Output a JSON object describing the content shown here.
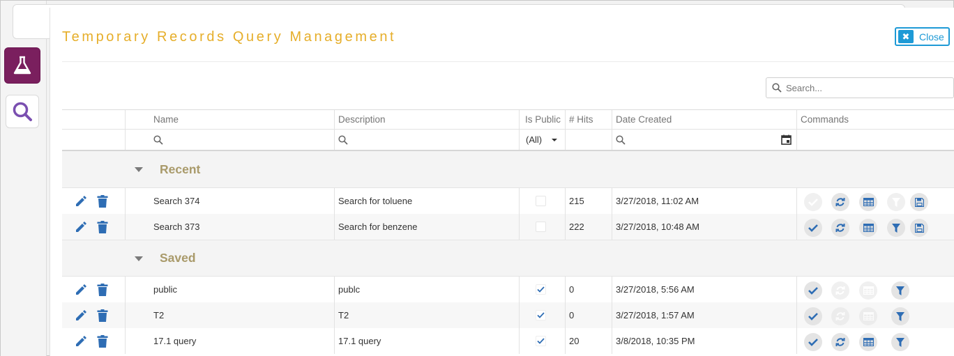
{
  "rail": {
    "items": [
      {
        "name": "table-view",
        "icon": "grid-table-icon",
        "color": "#e6ae2a"
      },
      {
        "name": "queries",
        "icon": "flask-icon",
        "color": "#7a1f5e"
      },
      {
        "name": "search",
        "icon": "magnifier-icon",
        "color": "#7a4fb0"
      }
    ]
  },
  "header": {
    "title": "Temporary Records Query Management",
    "close_label": "Close",
    "search_placeholder": "Search..."
  },
  "columns": {
    "name": "Name",
    "description": "Description",
    "is_public": "Is Public",
    "hits": "# Hits",
    "date_created": "Date Created",
    "commands": "Commands"
  },
  "filters": {
    "is_public_value": "(All)"
  },
  "groups": [
    {
      "label": "Recent",
      "rows": [
        {
          "name": "Search 374",
          "description": "Search for toluene",
          "is_public": false,
          "hits": "215",
          "date": "3/27/2018, 11:02 AM",
          "commands_enabled": [
            false,
            true,
            true,
            false,
            true
          ]
        },
        {
          "name": "Search 373",
          "description": "Search for benzene",
          "is_public": false,
          "hits": "222",
          "date": "3/27/2018, 10:48 AM",
          "commands_enabled": [
            true,
            true,
            true,
            true,
            true
          ]
        }
      ]
    },
    {
      "label": "Saved",
      "rows": [
        {
          "name": "public",
          "description": "publc",
          "is_public": true,
          "hits": "0",
          "date": "3/27/2018, 5:56 AM",
          "commands_enabled": [
            true,
            false,
            false,
            true
          ]
        },
        {
          "name": "T2",
          "description": "T2",
          "is_public": true,
          "hits": "0",
          "date": "3/27/2018, 1:57 AM",
          "commands_enabled": [
            true,
            false,
            false,
            true
          ]
        },
        {
          "name": "17.1 query",
          "description": "17.1 query",
          "is_public": true,
          "hits": "20",
          "date": "3/8/2018, 10:35 PM",
          "commands_enabled": [
            true,
            true,
            true,
            true
          ]
        }
      ]
    }
  ],
  "command_icons": [
    "check-icon",
    "refresh-icon",
    "table-icon",
    "filter-icon",
    "save-icon"
  ],
  "colors": {
    "accent": "#e6ae2a",
    "close_blue": "#1e9ad6",
    "icon_blue": "#2e6db4",
    "group_label": "#a99a6a",
    "flask_bg": "#7a1f5e"
  }
}
